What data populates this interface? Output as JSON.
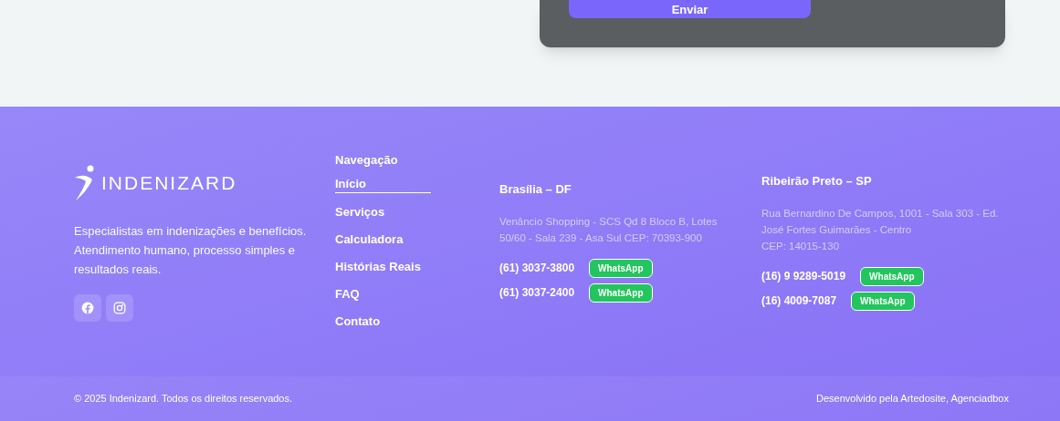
{
  "form_card": {
    "submit_button": "Enviar"
  },
  "footer": {
    "brand": "INDENIZARD",
    "tagline": "Especialistas em indenizações e benefícios. Atendimento humano, processo simples e resultados reais.",
    "social": [
      {
        "kind": "facebook"
      },
      {
        "kind": "instagram"
      }
    ],
    "navigation": {
      "title": "Navegação",
      "items": [
        {
          "label": "Início",
          "selected": true
        },
        {
          "label": "Serviços",
          "selected": false
        },
        {
          "label": "Calculadora",
          "selected": false
        },
        {
          "label": "Histórias Reais",
          "selected": false
        },
        {
          "label": "FAQ",
          "selected": false
        },
        {
          "label": "Contato",
          "selected": false
        }
      ]
    },
    "offices": [
      {
        "city": "Brasília – DF",
        "address": [
          "Venâncio Shopping - SCS Qd 8 Bloco B, Lotes 50/60 - Sala 239 - Asa Sul CEP: 70393-900"
        ],
        "phones": [
          {
            "number": "(61) 3037-3800",
            "button": "WhatsApp"
          },
          {
            "number": "(61) 3037-2400",
            "button": "WhatsApp"
          }
        ]
      },
      {
        "city": "Ribeirão Preto – SP",
        "address": [
          "Rua Bernardino De Campos, 1001 - Sala 303 - Ed. José Fortes Guimarães - Centro",
          "CEP: 14015-130"
        ],
        "phones": [
          {
            "number": "(16) 9 9289-5019",
            "button": "WhatsApp"
          },
          {
            "number": "(16) 4009-7087",
            "button": "WhatsApp"
          }
        ]
      }
    ],
    "copyright": "© 2025 Indenizard. Todos os direitos reservados.",
    "credits": "Desenvolvido pela Artedosite, Agenciadbox"
  }
}
